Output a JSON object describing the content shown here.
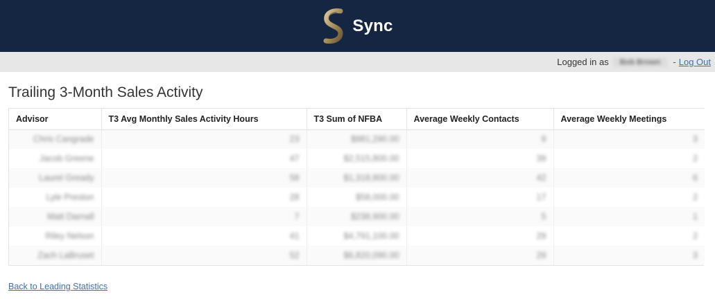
{
  "header": {
    "brand_name": "Sync",
    "logo_icon": "sync-s-logo-icon",
    "background_color": "#142641",
    "logo_color": "#b9a57a"
  },
  "userbar": {
    "logged_in_label": "Logged in as",
    "username": "Bob Brown",
    "separator": "-",
    "logout_label": "Log Out"
  },
  "page": {
    "title": "Trailing 3-Month Sales Activity"
  },
  "table": {
    "columns": [
      "Advisor",
      "T3 Avg Monthly Sales Activity Hours",
      "T3 Sum of NFBA",
      "Average Weekly Contacts",
      "Average Weekly Meetings"
    ],
    "rows": [
      [
        "Chris Cangrade",
        "23",
        "$981,290.00",
        "9",
        "3"
      ],
      [
        "Jacob Greene",
        "47",
        "$2,515,800.00",
        "39",
        "2"
      ],
      [
        "Laurel Gready",
        "58",
        "$1,318,800.00",
        "42",
        "6"
      ],
      [
        "Lyle Preston",
        "28",
        "$58,000.00",
        "17",
        "2"
      ],
      [
        "Matt Darnall",
        "7",
        "$238,900.00",
        "5",
        "1"
      ],
      [
        "Riley Nelson",
        "41",
        "$4,791,100.00",
        "29",
        "2"
      ],
      [
        "Zach LaBruset",
        "52",
        "$6,820,090.00",
        "29",
        "3"
      ]
    ]
  },
  "footer": {
    "back_link": "Back to Leading Statistics"
  }
}
